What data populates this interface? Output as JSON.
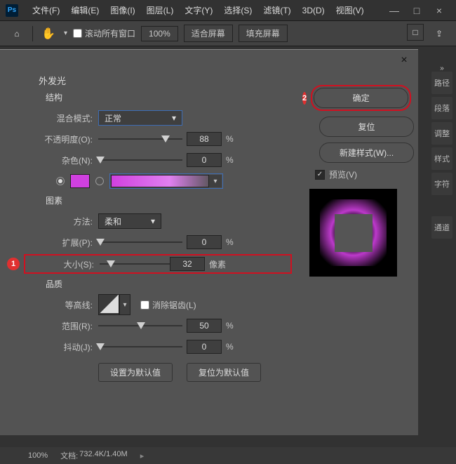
{
  "menubar": {
    "items": [
      "文件(F)",
      "编辑(E)",
      "图像(I)",
      "图层(L)",
      "文字(Y)",
      "选择(S)",
      "滤镜(T)",
      "3D(D)",
      "视图(V)"
    ]
  },
  "toolbar": {
    "scroll_all": "滚动所有窗口",
    "zoom": "100%",
    "fit_screen": "适合屏幕",
    "fill_screen": "填充屏幕"
  },
  "right_tabs": [
    "路径",
    "段落",
    "调整",
    "样式",
    "字符",
    "通道"
  ],
  "dialog": {
    "effect_title": "外发光",
    "sections": {
      "structure": "结构",
      "elements": "图素",
      "quality": "品质"
    },
    "labels": {
      "blend_mode": "混合模式:",
      "opacity": "不透明度(O):",
      "noise": "杂色(N):",
      "technique": "方法:",
      "spread": "扩展(P):",
      "size": "大小(S):",
      "contour": "等高线:",
      "range": "范围(R):",
      "jitter": "抖动(J):",
      "antialias": "消除锯齿(L)",
      "make_default": "设置为默认值",
      "reset_default": "复位为默认值"
    },
    "values": {
      "blend_mode": "正常",
      "opacity": "88",
      "noise": "0",
      "technique": "柔和",
      "spread": "0",
      "size": "32",
      "range": "50",
      "jitter": "0",
      "percent": "%",
      "px": "像素"
    },
    "buttons": {
      "ok": "确定",
      "reset": "复位",
      "new_style": "新建样式(W)...",
      "preview": "预览(V)"
    },
    "badges": {
      "one": "1",
      "two": "2"
    }
  },
  "statusbar": {
    "zoom": "100%",
    "doc_label": "文档:",
    "doc_value": "732.4K/1.40M"
  }
}
